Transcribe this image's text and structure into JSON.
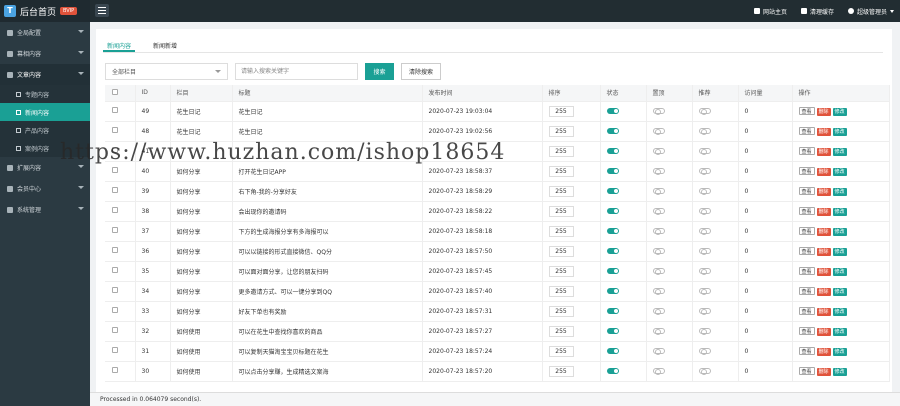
{
  "brand": {
    "title": "后台首页",
    "badge": "BVIP",
    "logo": "T"
  },
  "topbar": {
    "items": [
      {
        "icon": "home-icon",
        "label": "网站主页"
      },
      {
        "icon": "trash-icon",
        "label": "清理缓存"
      },
      {
        "icon": "user-icon",
        "label": "超级管理员"
      }
    ]
  },
  "sidebar": {
    "items": [
      {
        "label": "全局配置"
      },
      {
        "label": "幕相内容"
      },
      {
        "label": "文章内容"
      },
      {
        "label": "扩展内容"
      },
      {
        "label": "会员中心"
      },
      {
        "label": "系统管理"
      }
    ],
    "subitems": [
      {
        "label": "专题内容"
      },
      {
        "label": "新闻内容"
      },
      {
        "label": "产品内容"
      },
      {
        "label": "案例内容"
      }
    ]
  },
  "tabs": [
    {
      "label": "新闻内容"
    },
    {
      "label": "新闻新增"
    }
  ],
  "filters": {
    "column_select": "全部栏目",
    "search_placeholder": "请输入搜索关键字",
    "search_button": "搜索",
    "clear_button": "清除搜索"
  },
  "table": {
    "headers": [
      "",
      "ID",
      "栏目",
      "标题",
      "发布时间",
      "排序",
      "状态",
      "置顶",
      "推荐",
      "访问量",
      "操作"
    ],
    "actions": {
      "view": "查看",
      "del": "删除",
      "edit": "修改"
    },
    "rows": [
      {
        "id": "49",
        "column": "花生日记",
        "title": "花生日记",
        "time": "2020-07-23 19:03:04",
        "sort": "255",
        "status": "on",
        "top": "off",
        "rec": "off",
        "views": "0"
      },
      {
        "id": "48",
        "column": "花生日记",
        "title": "花生日记",
        "time": "2020-07-23 19:02:56",
        "sort": "255",
        "status": "on",
        "top": "off",
        "rec": "off",
        "views": "0"
      },
      {
        "id": "41",
        "column": "",
        "title": "",
        "time": "",
        "sort": "255",
        "status": "on",
        "top": "off",
        "rec": "off",
        "views": "0"
      },
      {
        "id": "40",
        "column": "如何分享",
        "title": "打开花生日记APP",
        "time": "2020-07-23 18:58:37",
        "sort": "255",
        "status": "on",
        "top": "off",
        "rec": "off",
        "views": "0"
      },
      {
        "id": "39",
        "column": "如何分享",
        "title": "右下角-我的-分享好友",
        "time": "2020-07-23 18:58:29",
        "sort": "255",
        "status": "on",
        "top": "off",
        "rec": "off",
        "views": "0"
      },
      {
        "id": "38",
        "column": "如何分享",
        "title": "会出现你的邀请码",
        "time": "2020-07-23 18:58:22",
        "sort": "255",
        "status": "on",
        "top": "off",
        "rec": "off",
        "views": "0"
      },
      {
        "id": "37",
        "column": "如何分享",
        "title": "下方的生成海报分享有多海报可以",
        "time": "2020-07-23 18:58:18",
        "sort": "255",
        "status": "on",
        "top": "off",
        "rec": "off",
        "views": "0"
      },
      {
        "id": "36",
        "column": "如何分享",
        "title": "可以以链接的形式直接微信、QQ分",
        "time": "2020-07-23 18:57:50",
        "sort": "255",
        "status": "on",
        "top": "off",
        "rec": "off",
        "views": "0"
      },
      {
        "id": "35",
        "column": "如何分享",
        "title": "可以面对面分享，让您的朋友扫码",
        "time": "2020-07-23 18:57:45",
        "sort": "255",
        "status": "on",
        "top": "off",
        "rec": "off",
        "views": "0"
      },
      {
        "id": "34",
        "column": "如何分享",
        "title": "更多邀请方式、可以一键分享到QQ",
        "time": "2020-07-23 18:57:40",
        "sort": "255",
        "status": "on",
        "top": "off",
        "rec": "off",
        "views": "0"
      },
      {
        "id": "33",
        "column": "如何分享",
        "title": "好友下单也有奖励",
        "time": "2020-07-23 18:57:31",
        "sort": "255",
        "status": "on",
        "top": "off",
        "rec": "off",
        "views": "0"
      },
      {
        "id": "32",
        "column": "如何使用",
        "title": "可以在花生中查找你喜欢的商品",
        "time": "2020-07-23 18:57:27",
        "sort": "255",
        "status": "on",
        "top": "off",
        "rec": "off",
        "views": "0"
      },
      {
        "id": "31",
        "column": "如何使用",
        "title": "可以复制天猫淘宝宝贝标题在花生",
        "time": "2020-07-23 18:57:24",
        "sort": "255",
        "status": "on",
        "top": "off",
        "rec": "off",
        "views": "0"
      },
      {
        "id": "30",
        "column": "如何使用",
        "title": "可以点击分享赚，生成精选文案海",
        "time": "2020-07-23 18:57:20",
        "sort": "255",
        "status": "on",
        "top": "off",
        "rec": "off",
        "views": "0"
      }
    ]
  },
  "footer": {
    "text": "Processed in 0.064079 second(s)."
  },
  "watermark": "https://www.huzhan.com/ishop18654",
  "colors": {
    "accent": "#1aa095",
    "danger": "#e0533b",
    "sidebar": "#2b3a42",
    "topbar": "#222d32"
  }
}
